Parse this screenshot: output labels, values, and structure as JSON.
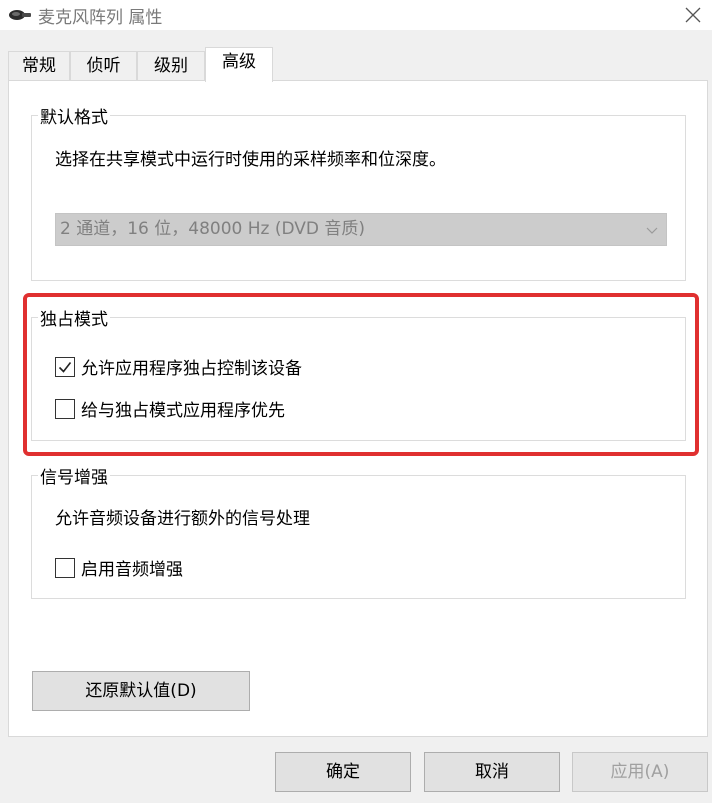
{
  "window": {
    "title": "麦克风阵列 属性",
    "title_icon": "microphone-icon",
    "close_icon": "close-icon"
  },
  "tabs": [
    {
      "label": "常规",
      "active": false
    },
    {
      "label": "侦听",
      "active": false
    },
    {
      "label": "级别",
      "active": false
    },
    {
      "label": "高级",
      "active": true
    }
  ],
  "default_format": {
    "legend": "默认格式",
    "description": "选择在共享模式中运行时使用的采样频率和位深度。",
    "selected_value": "2 通道，16 位，48000 Hz (DVD 音质)",
    "disabled": true
  },
  "exclusive_mode": {
    "legend": "独占模式",
    "options": [
      {
        "label": "允许应用程序独占控制该设备",
        "checked": true
      },
      {
        "label": "给与独占模式应用程序优先",
        "checked": false
      }
    ],
    "highlight_color": "#e03030"
  },
  "signal_enhancement": {
    "legend": "信号增强",
    "description": "允许音频设备进行额外的信号处理",
    "option": {
      "label": "启用音频增强",
      "checked": false
    }
  },
  "buttons": {
    "restore_defaults": "还原默认值(D)",
    "ok": "确定",
    "cancel": "取消",
    "apply": "应用(A)"
  }
}
